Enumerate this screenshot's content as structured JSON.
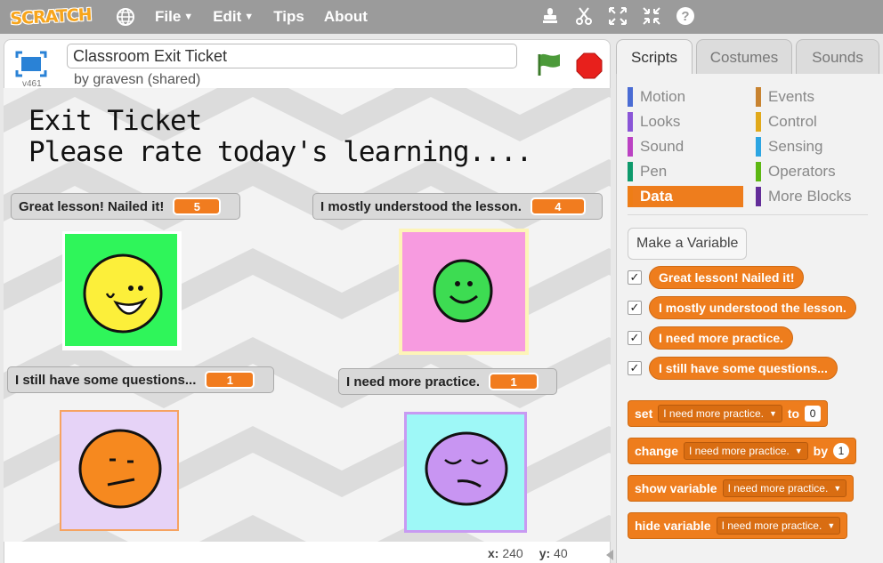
{
  "menubar": {
    "logo": "SCRATCH",
    "items": [
      {
        "label": "File",
        "has_caret": true
      },
      {
        "label": "Edit",
        "has_caret": true
      },
      {
        "label": "Tips",
        "has_caret": false
      },
      {
        "label": "About",
        "has_caret": false
      }
    ],
    "tools": [
      "duplicate-stamp-icon",
      "cut-scissors-icon",
      "grow-icon",
      "shrink-icon",
      "help-icon"
    ]
  },
  "project": {
    "version": "v461",
    "title": "Classroom Exit Ticket",
    "byline": "by gravesn (shared)"
  },
  "stage": {
    "title_line1": "Exit Ticket",
    "title_line2": "Please rate today's learning....",
    "monitors": [
      {
        "label": "Great lesson! Nailed it!",
        "value": "5"
      },
      {
        "label": "I mostly understood the lesson.",
        "value": "4"
      },
      {
        "label": "I still have some questions...",
        "value": "1"
      },
      {
        "label": "I need more practice.",
        "value": "1"
      }
    ],
    "faces": [
      {
        "name": "laughing-face",
        "bg": "#2ff55a",
        "face": "#fcef3a"
      },
      {
        "name": "smiling-face",
        "bg": "#f79be0",
        "face": "#3ddc52"
      },
      {
        "name": "neutral-face",
        "bg": "#e6d3f7",
        "face": "#f6891f"
      },
      {
        "name": "sad-face",
        "bg": "#9ef8f7",
        "face": "#c895f2"
      }
    ]
  },
  "coords": {
    "x_label": "x:",
    "x": "240",
    "y_label": "y:",
    "y": "40"
  },
  "tabs": [
    "Scripts",
    "Costumes",
    "Sounds"
  ],
  "categories": [
    {
      "label": "Motion",
      "color": "#4a6cd4"
    },
    {
      "label": "Events",
      "color": "#c88330"
    },
    {
      "label": "Looks",
      "color": "#8a55d7"
    },
    {
      "label": "Control",
      "color": "#e1a91a"
    },
    {
      "label": "Sound",
      "color": "#bb42c3"
    },
    {
      "label": "Sensing",
      "color": "#2ca5e2"
    },
    {
      "label": "Pen",
      "color": "#0e9a6c"
    },
    {
      "label": "Operators",
      "color": "#5cb712"
    },
    {
      "label": "Data",
      "color": "#ee7d16"
    },
    {
      "label": "More Blocks",
      "color": "#632d99"
    }
  ],
  "palette": {
    "make_variable": "Make a Variable",
    "variables": [
      "Great lesson! Nailed it!",
      "I mostly understood the lesson.",
      "I need more practice.",
      "I still have some questions..."
    ],
    "check_mark": "✓",
    "set_block": {
      "word1": "set",
      "dropdown": "I need more practice.",
      "word2": "to",
      "value": "0"
    },
    "change_block": {
      "word1": "change",
      "dropdown": "I need more practice.",
      "word2": "by",
      "value": "1"
    },
    "show_block": {
      "word1": "show variable",
      "dropdown": "I need more practice."
    },
    "hide_block": {
      "word1": "hide variable",
      "dropdown": "I need more practice."
    }
  }
}
